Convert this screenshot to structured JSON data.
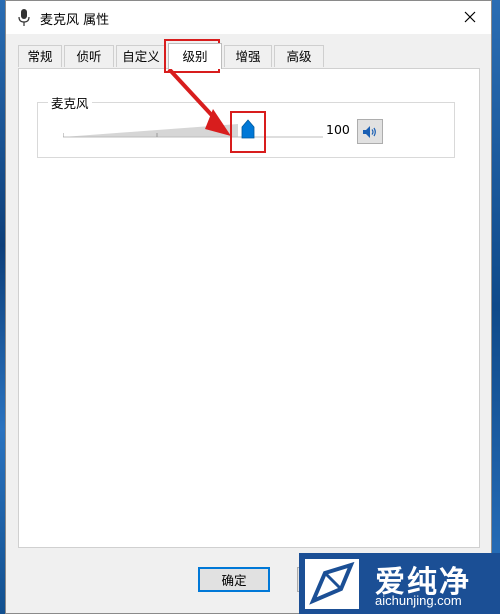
{
  "window": {
    "title": "麦克风 属性"
  },
  "tabs": [
    {
      "label": "常规"
    },
    {
      "label": "侦听"
    },
    {
      "label": "自定义"
    },
    {
      "label": "级别"
    },
    {
      "label": "增强"
    },
    {
      "label": "高级"
    }
  ],
  "active_tab": "级别",
  "levels": {
    "group_label": "麦克风",
    "volume_value": "100",
    "volume_level": 1.0,
    "mute_icon": "speaker-icon"
  },
  "buttons": {
    "ok": "确定"
  },
  "annotation": {
    "color": "#d81d1d"
  },
  "watermark": {
    "title": "爱纯净",
    "url": "aichunjing.com"
  },
  "colors": {
    "accent": "#0078d7",
    "thumb": "#0078d7"
  }
}
